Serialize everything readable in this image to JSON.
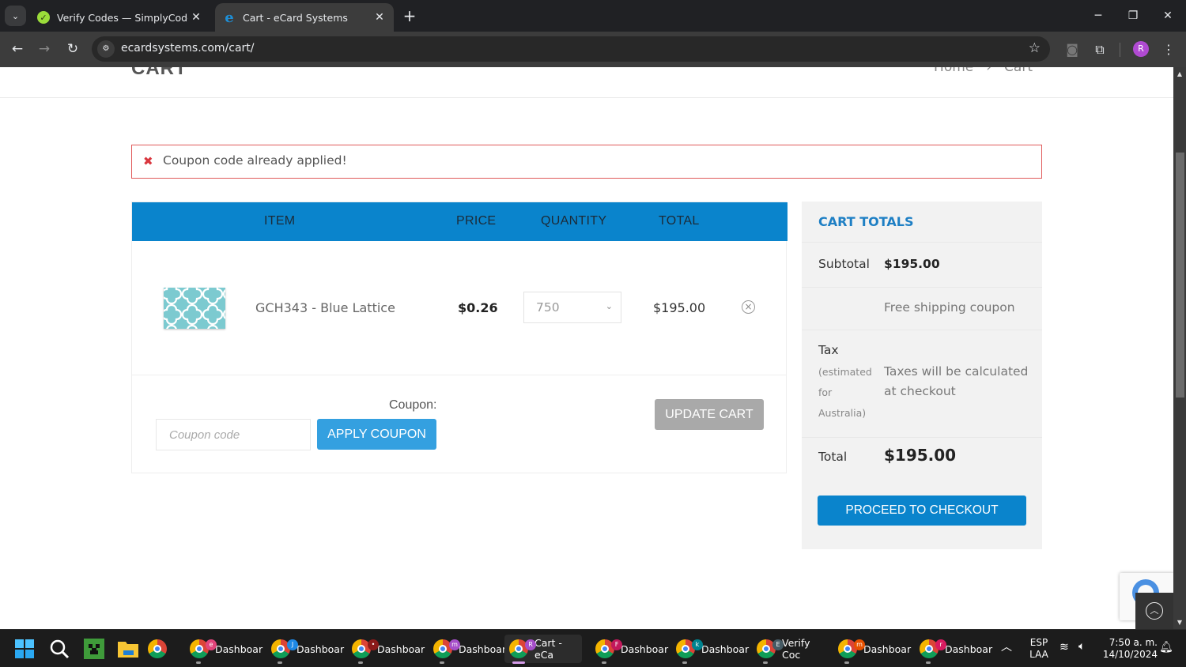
{
  "browser": {
    "tabs": [
      {
        "title": "Verify Codes — SimplyCodes",
        "active": false,
        "favicon": "simplycodes-icon"
      },
      {
        "title": "Cart - eCard Systems",
        "active": true,
        "favicon": "ecard-e-icon"
      }
    ],
    "favicon_letter": "e",
    "url": "ecardsystems.com/cart/",
    "profile_initial": "R"
  },
  "page": {
    "title": "CART",
    "breadcrumb": [
      "Home",
      "›",
      "Cart"
    ],
    "error_message": "Coupon code already applied!",
    "error_color": "#d9363e",
    "accent_color": "#0a84cc"
  },
  "cart": {
    "columns": [
      "ITEM",
      "PRICE",
      "QUANTITY",
      "TOTAL"
    ],
    "items": [
      {
        "name": "GCH343 - Blue Lattice",
        "price": "$0.26",
        "quantity": "750",
        "total": "$195.00"
      }
    ],
    "coupon_label": "Coupon:",
    "coupon_placeholder": "Coupon code",
    "coupon_value": "",
    "apply_coupon_label": "APPLY COUPON",
    "update_cart_label": "UPDATE CART"
  },
  "totals": {
    "heading": "CART TOTALS",
    "subtotal_label": "Subtotal",
    "subtotal_value": "$195.00",
    "shipping_note": "Free shipping coupon",
    "tax_label": "Tax",
    "tax_sub": [
      "(estimated",
      "for",
      "Australia)"
    ],
    "tax_note": "Taxes will be calculated at checkout",
    "total_label": "Total",
    "total_value": "$195.00",
    "checkout_label": "PROCEED TO CHECKOUT"
  },
  "taskbar": {
    "apps": [
      {
        "label": "Dashboar",
        "badge": "e",
        "badge_color": "#e0457b"
      },
      {
        "label": "Dashboar",
        "badge": "J",
        "badge_color": "#1e88e5"
      },
      {
        "label": "Dashboar",
        "badge": "•",
        "badge_color": "#8b1a1a"
      },
      {
        "label": "Dashboar",
        "badge": "m",
        "badge_color": "#a64fc9"
      },
      {
        "label": "Cart - eCa",
        "badge": "R",
        "badge_color": "#a64fc9",
        "active": true
      },
      {
        "label": "Dashboar",
        "badge": "F",
        "badge_color": "#c2185b"
      },
      {
        "label": "Dashboar",
        "badge": "k",
        "badge_color": "#00838f"
      },
      {
        "label": "Verify Coc",
        "badge": "E",
        "badge_color": "#455a64"
      },
      {
        "label": "Dashboar",
        "badge": "m",
        "badge_color": "#e65100"
      },
      {
        "label": "Dashboar",
        "badge": "r",
        "badge_color": "#d81b60"
      }
    ],
    "lang_1": "ESP",
    "lang_2": "LAA",
    "time": "7:50 a. m.",
    "date": "14/10/2024"
  }
}
